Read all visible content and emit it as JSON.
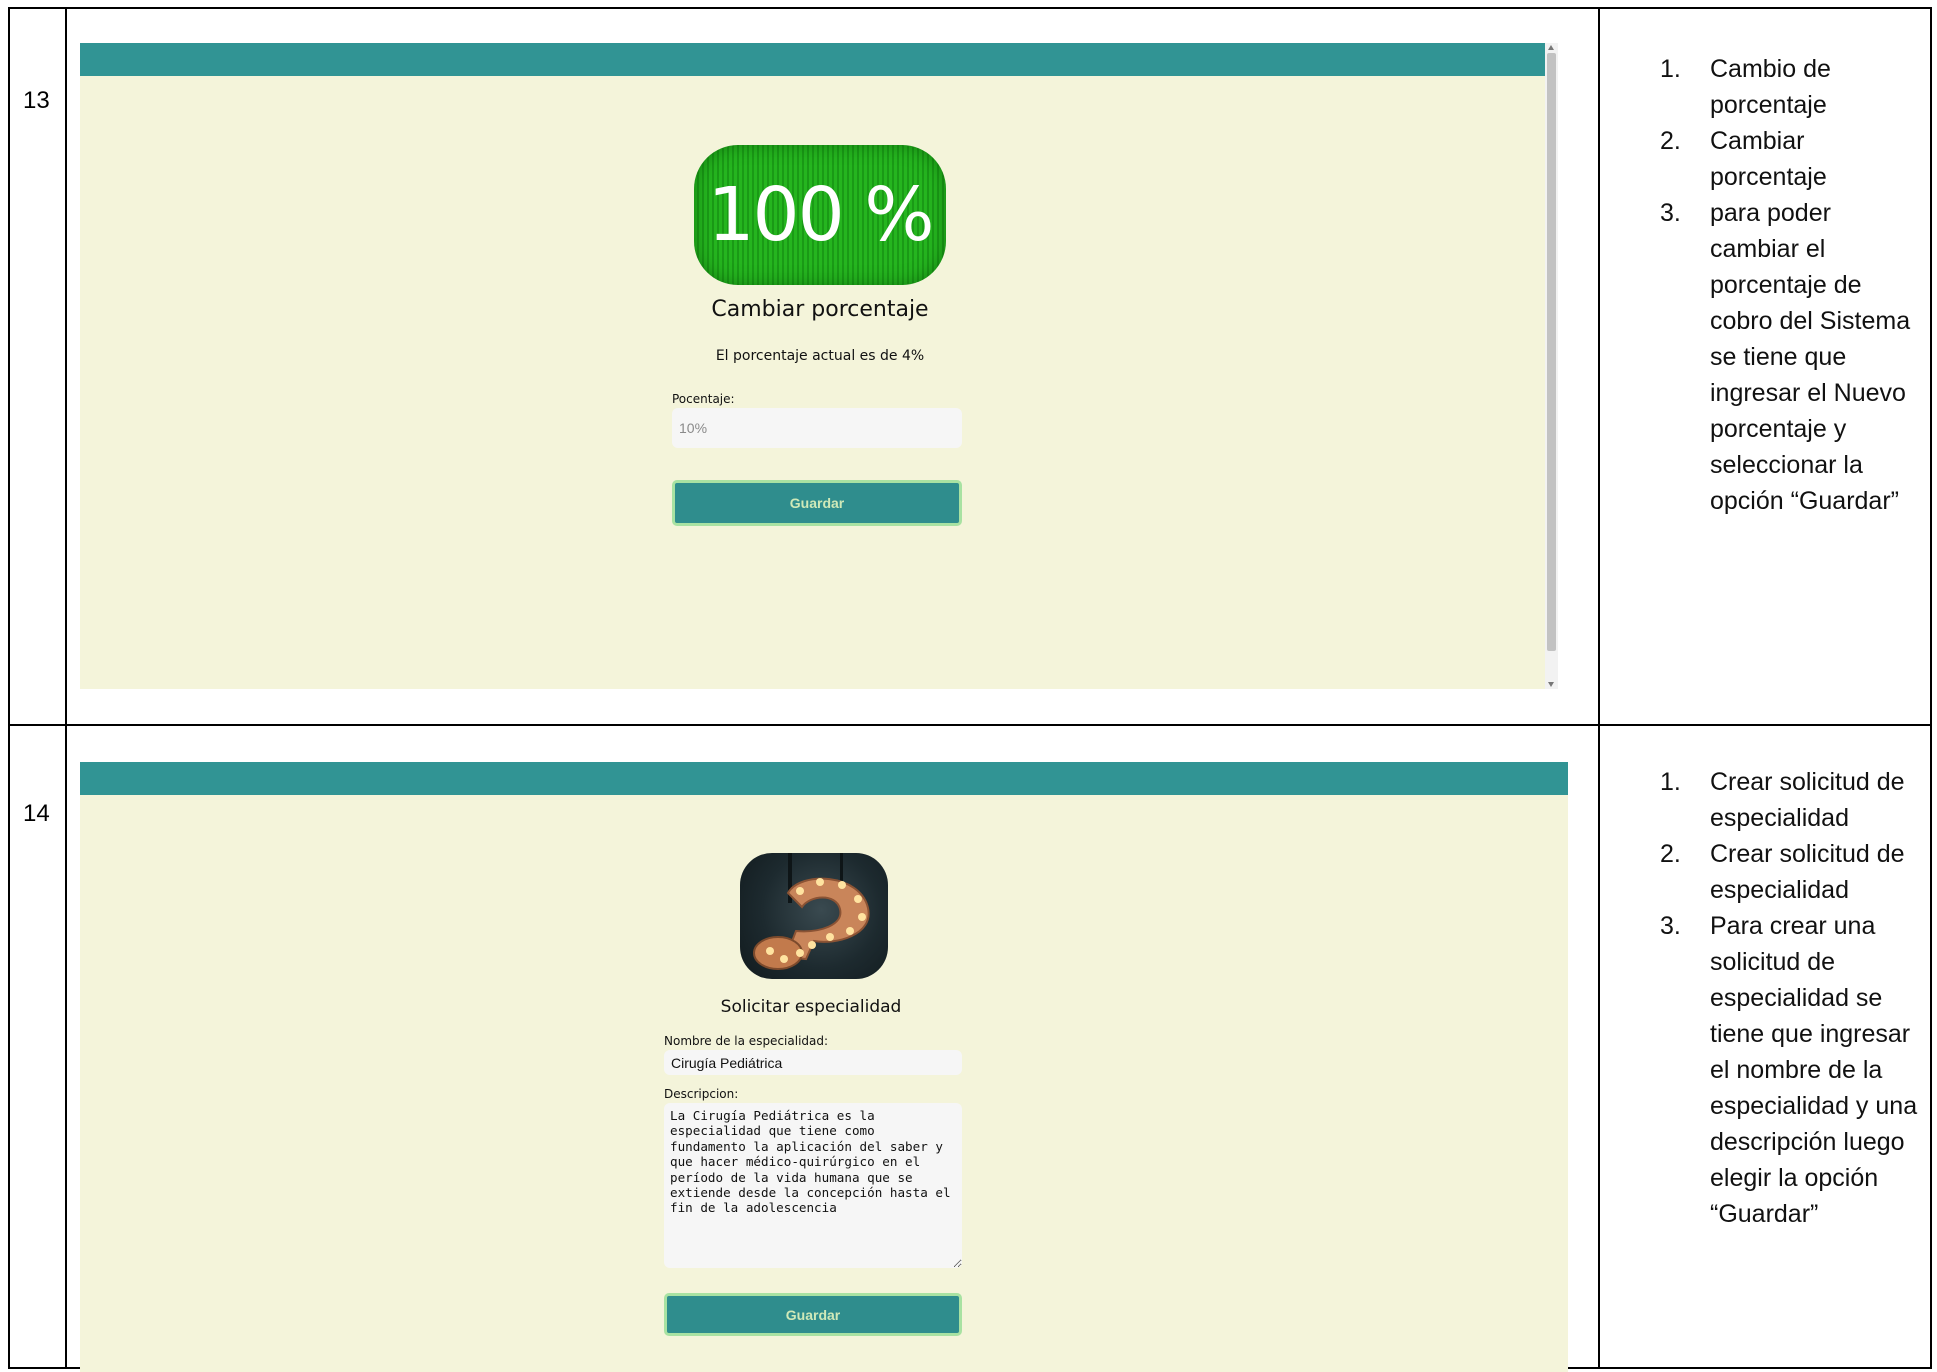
{
  "rows": [
    {
      "number": "13",
      "screen": {
        "logo_text": "100 %",
        "title": "Cambiar porcentaje",
        "subtitle": "El porcentaje actual es de 4%",
        "field_label": "Pocentaje:",
        "field_placeholder": "10%",
        "button_label": "Guardar"
      },
      "steps": [
        {
          "n": "1.",
          "text": "Cambio de porcentaje"
        },
        {
          "n": "2.",
          "text": "Cambiar porcentaje"
        },
        {
          "n": "3.",
          "text": "para poder cambiar el porcentaje de cobro del Sistema se tiene que ingresar el Nuevo porcentaje y seleccionar la opción “Guardar”"
        }
      ]
    },
    {
      "number": "14",
      "screen": {
        "title": "Solicitar especialidad",
        "name_label": "Nombre de la especialidad:",
        "name_value": "Cirugía Pediátrica",
        "desc_label": "Descripcion:",
        "desc_value": "La Cirugía Pediátrica es la especialidad que tiene como fundamento la aplicación del saber y que hacer médico-quirúrgico en el período de la vida humana que se extiende desde la concepción hasta el fin de la adolescencia",
        "button_label": "Guardar"
      },
      "steps": [
        {
          "n": "1.",
          "text": "Crear solicitud de especialidad"
        },
        {
          "n": "2.",
          "text": "Crear solicitud de especialidad"
        },
        {
          "n": "3.",
          "text": "Para crear una solicitud de especialidad se tiene que ingresar el nombre de la especialidad y una descripción luego elegir la opción “Guardar”"
        }
      ]
    }
  ],
  "colors": {
    "topbar": "#319494",
    "background": "#f4f4da",
    "button": "#2f8d8d",
    "button_border": "#a8e2a2",
    "percent_badge": "#25b51f"
  },
  "icons": {
    "row13_logo": "percent-badge-icon",
    "row14_logo": "question-mark-icon"
  }
}
